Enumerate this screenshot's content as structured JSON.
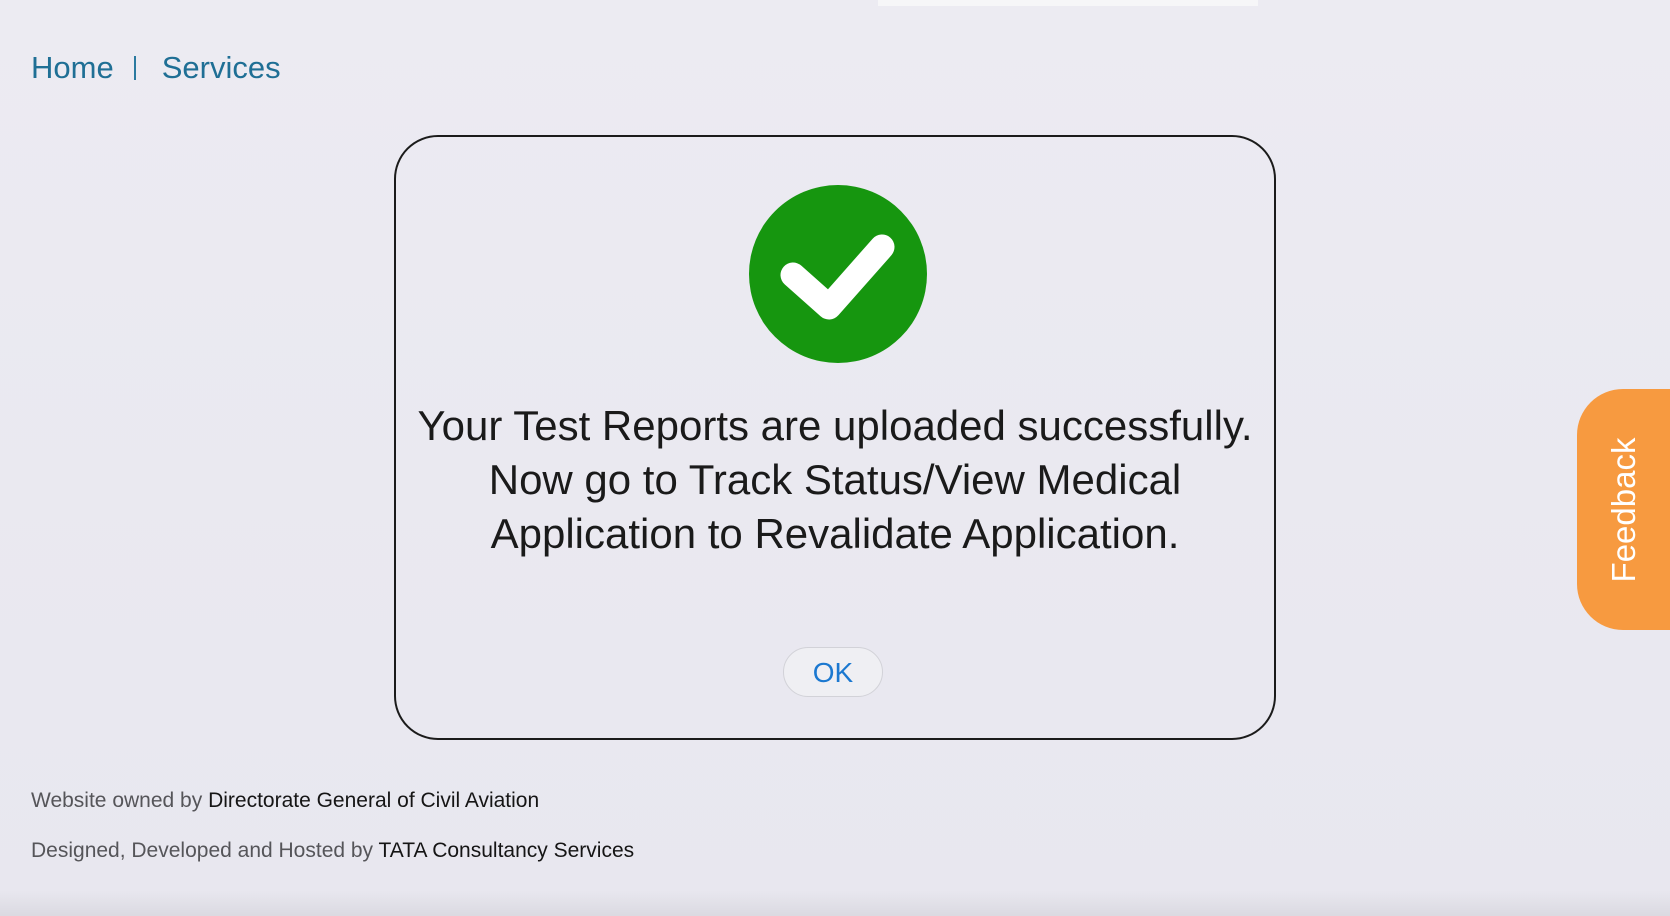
{
  "breadcrumb": {
    "home": "Home",
    "services": "Services"
  },
  "modal": {
    "icon": "check-circle-icon",
    "message_lines": [
      "Your Test Reports are uploaded successfully.",
      "Now go to Track Status/View Medical",
      "Application to Revalidate Application."
    ],
    "ok_label": "OK"
  },
  "feedback": {
    "label": "Feedback"
  },
  "footer": {
    "owned_prefix": "Website owned by",
    "owned_by": "Directorate General of Civil Aviation",
    "designed_prefix": "Designed, Developed and Hosted by",
    "designed_by": "TATA Consultancy Services"
  },
  "colors": {
    "link": "#1f6f95",
    "success_green": "#16960f",
    "ok_text": "#1b78d0",
    "feedback_orange": "#f79a40",
    "background": "#ecebf2"
  }
}
